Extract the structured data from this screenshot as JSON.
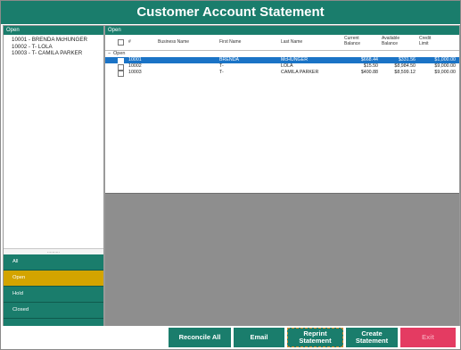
{
  "window": {
    "title": "Customer Account Statement"
  },
  "left_panel": {
    "header": "Open",
    "customers": [
      "10001 - BRENDA McHUNGER",
      "10002 - T- LOLA",
      "10003 - T- CAMILA PARKER"
    ],
    "grip": "..........",
    "nav": [
      {
        "label": "All"
      },
      {
        "label": "Open",
        "active": true
      },
      {
        "label": "Hold"
      },
      {
        "label": "Closed"
      }
    ]
  },
  "right_panel": {
    "header": "Open",
    "columns": {
      "num": "#",
      "business": "Business Name",
      "first": "First Name",
      "last": "Last Name",
      "current": [
        "Current",
        "Balance"
      ],
      "available": [
        "Available",
        "Balance"
      ],
      "credit": [
        "Credit",
        "Limit"
      ]
    },
    "group_label": "Open",
    "group_toggle": "−",
    "rows": [
      {
        "num": "10001",
        "business": "",
        "first": "BRENDA",
        "last": "McHUNGER",
        "current": "$668.44",
        "available": "$331.56",
        "credit": "$1,000.00",
        "selected": true
      },
      {
        "num": "10002",
        "business": "",
        "first": "T-",
        "last": "LOLA",
        "current": "$15.50",
        "available": "$8,984.50",
        "credit": "$9,000.00",
        "selected": false
      },
      {
        "num": "10003",
        "business": "",
        "first": "T-",
        "last": "CAMILA PARKER",
        "current": "$400.88",
        "available": "$8,599.12",
        "credit": "$9,000.00",
        "selected": false
      }
    ]
  },
  "buttons": {
    "reconcile": "Reconcile All",
    "email": "Email",
    "reprint": [
      "Reprint",
      "Statement"
    ],
    "create": [
      "Create",
      "Statement"
    ],
    "exit": "Exit"
  },
  "colors": {
    "teal": "#1a7d6c",
    "gold": "#d3a400",
    "selection": "#1a73c6",
    "exit": "#e43b62"
  }
}
